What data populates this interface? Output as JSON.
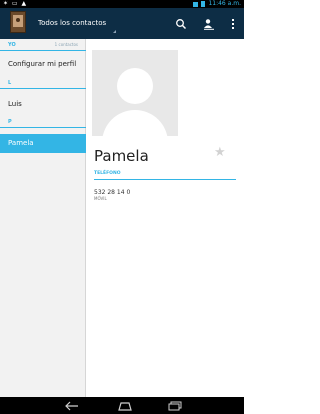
{
  "status_bar": {
    "time": "11:46",
    "ampm": "a.m."
  },
  "action_bar": {
    "title": "Todos los contactos",
    "icons": [
      "search-icon",
      "add-contact-icon",
      "overflow-menu-icon"
    ]
  },
  "sidebar": {
    "sections": [
      {
        "letter": "YO",
        "count": "1 contactos"
      },
      {
        "letter": "L"
      },
      {
        "letter": "P"
      }
    ],
    "items": [
      {
        "label": "Configurar mi perfil"
      },
      {
        "label": "Luis"
      },
      {
        "label": "Pamela",
        "selected": true
      }
    ]
  },
  "detail": {
    "name": "Pamela",
    "phone_section_label": "TELÉFONO",
    "phone_number": "532 28 14 0",
    "phone_type": "MÓVIL"
  },
  "colors": {
    "accent": "#33b5e5",
    "action_bar": "#0d2d45",
    "selected_row": "#33b5e5"
  }
}
